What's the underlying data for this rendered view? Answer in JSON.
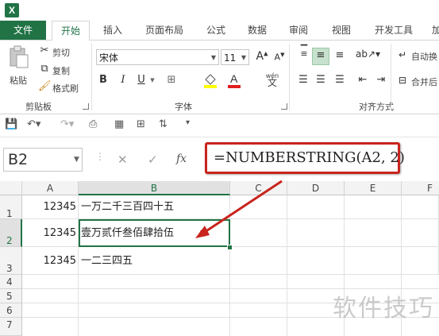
{
  "app": {
    "icon_letter": "X"
  },
  "tabs": [
    {
      "label": "文件"
    },
    {
      "label": "开始"
    },
    {
      "label": "插入"
    },
    {
      "label": "页面布局"
    },
    {
      "label": "公式"
    },
    {
      "label": "数据"
    },
    {
      "label": "审阅"
    },
    {
      "label": "视图"
    },
    {
      "label": "开发工具"
    },
    {
      "label": "加"
    }
  ],
  "ribbon": {
    "clipboard": {
      "paste": "粘贴",
      "cut": "剪切",
      "copy": "复制",
      "format_painter": "格式刷",
      "group_label": "剪贴板"
    },
    "font": {
      "font_name": "宋体",
      "font_size": "11",
      "grow": "A",
      "shrink": "A",
      "bold": "B",
      "italic": "I",
      "underline": "U",
      "phonetic": "wén",
      "group_label": "字体"
    },
    "alignment": {
      "wrap_text": "自动换",
      "merge": "合并后",
      "group_label": "对齐方式"
    }
  },
  "formula_bar": {
    "name_box": "B2",
    "cancel": "✕",
    "enter": "✓",
    "fx": "fx",
    "formula": "=NUMBERSTRING(A2, 2)"
  },
  "sheet": {
    "columns": [
      "A",
      "B",
      "C",
      "D",
      "E",
      "F"
    ],
    "rows": [
      "1",
      "2",
      "3",
      "4",
      "5",
      "6",
      "7"
    ],
    "cells": {
      "A1": "12345",
      "B1": "一万二千三百四十五",
      "A2": "12345",
      "B2": "壹万贰仟叁佰肆拾伍",
      "A3": "12345",
      "B3": "一二三四五"
    }
  },
  "watermark": "软件技巧",
  "colors": {
    "accent": "#217346",
    "annotation": "#c8241d"
  }
}
